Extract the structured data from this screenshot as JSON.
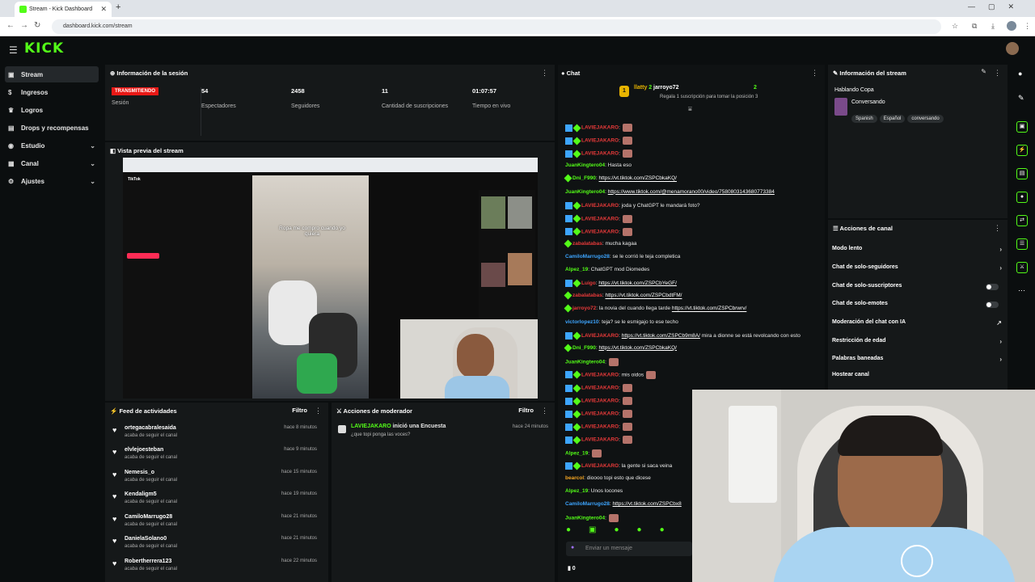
{
  "browser": {
    "tab_title": "Stream - Kick Dashboard",
    "url": "dashboard.kick.com/stream"
  },
  "topbar": {
    "logo": "KICK"
  },
  "sidebar": {
    "items": [
      {
        "label": "Stream",
        "icon": "broadcast-icon",
        "active": true
      },
      {
        "label": "Ingresos",
        "icon": "money-icon"
      },
      {
        "label": "Logros",
        "icon": "trophy-icon"
      },
      {
        "label": "Drops y recompensas",
        "icon": "gift-icon"
      },
      {
        "label": "Estudio",
        "icon": "studio-icon",
        "expandable": true
      },
      {
        "label": "Canal",
        "icon": "channel-icon",
        "expandable": true
      },
      {
        "label": "Ajustes",
        "icon": "gear-icon",
        "expandable": true
      }
    ]
  },
  "session": {
    "title": "Información de la sesión",
    "status": "TRANSMITIENDO",
    "status_label": "Sesión",
    "stats": [
      {
        "value": "54",
        "label": "Espectadores"
      },
      {
        "value": "2458",
        "label": "Seguidores"
      },
      {
        "value": "11",
        "label": "Cantidad de suscripciones"
      },
      {
        "value": "01:07:57",
        "label": "Tiempo en vivo"
      }
    ]
  },
  "preview": {
    "title": "Vista previa del stream",
    "caption": "Ropa me compro cuando yo quiera"
  },
  "feed": {
    "title": "Feed de actividades",
    "filter": "Filtro",
    "items": [
      {
        "name": "ortegacabralesaida",
        "action": "acaba de seguir el canal",
        "time": "hace 8 minutos"
      },
      {
        "name": "elvlejoesteban",
        "action": "acaba de seguir el canal",
        "time": "hace 9 minutos"
      },
      {
        "name": "Nemesis_o",
        "action": "acaba de seguir el canal",
        "time": "hace 15 minutos"
      },
      {
        "name": "Kendaligm5",
        "action": "acaba de seguir el canal",
        "time": "hace 19 minutos"
      },
      {
        "name": "CamiloMarrugo28",
        "action": "acaba de seguir el canal",
        "time": "hace 21 minutos"
      },
      {
        "name": "DanielaSolano0",
        "action": "acaba de seguir el canal",
        "time": "hace 21 minutos"
      },
      {
        "name": "Robertherrera123",
        "action": "acaba de seguir el canal",
        "time": "hace 22 minutos"
      }
    ]
  },
  "mod": {
    "title": "Acciones de moderador",
    "filter": "Filtro",
    "item": {
      "user": "LAVIEJAKARO",
      "action": "inició una Encuesta",
      "detail": "¿que topi ponga las voces?",
      "time": "hace 24 minutos"
    }
  },
  "chat": {
    "title": "Chat",
    "pinned": {
      "rank": "1",
      "user1": "llatty",
      "count1": "2",
      "user2": "jarroyo72",
      "count2": "2",
      "text": "Regala 1 suscripción para tomar la posición 3"
    },
    "messages": [
      {
        "user": "LAVIEJAKARO",
        "color": "#e93a3a",
        "text": ":",
        "link": "",
        "emote": true,
        "badges": true
      },
      {
        "user": "LAVIEJAKARO",
        "color": "#e93a3a",
        "text": ":",
        "link": "",
        "emote": true,
        "badges": true
      },
      {
        "user": "LAVIEJAKARO",
        "color": "#e93a3a",
        "text": ":",
        "link": "",
        "emote": true,
        "badges": true
      },
      {
        "user": "JuanKingtero04",
        "color": "#53fc18",
        "text": ": Hasta eso",
        "link": ""
      },
      {
        "user": "Dni_F990",
        "color": "#53fc18",
        "text": ": ",
        "link": "https://vt.tiktok.com/ZSPCbkaKQ/",
        "badge1": true
      },
      {
        "user": "JuanKingtero04",
        "color": "#53fc18",
        "text": ": ",
        "link": "https://www.tiktok.com/@menamorano00/video/7580803143680773384"
      },
      {
        "user": "LAVIEJAKARO",
        "color": "#e93a3a",
        "text": ": joda y ChatGPT le mandará foto?",
        "link": "",
        "badges": true
      },
      {
        "user": "LAVIEJAKARO",
        "color": "#e93a3a",
        "text": ":",
        "link": "",
        "emote": true,
        "badges": true
      },
      {
        "user": "LAVIEJAKARO",
        "color": "#e93a3a",
        "text": ":",
        "link": "",
        "emote": true,
        "badges": true
      },
      {
        "user": "zabalatabas",
        "color": "#e93a3a",
        "text": ": mucha kagaa",
        "link": "",
        "badge1": true
      },
      {
        "user": "CamiloMarrugo28",
        "color": "#3da5ff",
        "text": ": se le corrió le teja completica",
        "link": ""
      },
      {
        "user": "Alpez_19",
        "color": "#53fc18",
        "text": ": ChatGPT mod Diomedes",
        "link": ""
      },
      {
        "user": "Luigo",
        "color": "#e93a3a",
        "text": ": ",
        "link": "https://vt.tiktok.com/ZSPCbYeGF/",
        "badges": true
      },
      {
        "user": "zabalatabas",
        "color": "#e93a3a",
        "text": ": ",
        "link": "https://vt.tiktok.com/ZSPCbdtFM/",
        "badge1": true
      },
      {
        "user": "jarroyo72",
        "color": "#e93a3a",
        "text": ": la novia del cuando llega tarde ",
        "link": "https://vt.tiktok.com/ZSPCbrwrv/",
        "badge1": true
      },
      {
        "user": "victorlopez10",
        "color": "#3da5ff",
        "text": ": teja? se le esmigajo to ese techo",
        "link": ""
      },
      {
        "user": "LAVIEJAKARO",
        "color": "#e93a3a",
        "text": ": ",
        "link": "https://vt.tiktok.com/ZSPCb9m8A/",
        "after": " mira a dionne se está revolcando con esto",
        "badges": true
      },
      {
        "user": "Dni_F990",
        "color": "#53fc18",
        "text": ": ",
        "link": "https://vt.tiktok.com/ZSPCbkaKQ/",
        "badge1": true
      },
      {
        "user": "JuanKingtero04",
        "color": "#53fc18",
        "text": ":",
        "link": "",
        "emote": true
      },
      {
        "user": "LAVIEJAKARO",
        "color": "#e93a3a",
        "text": ": mis oidos",
        "link": "",
        "emote": true,
        "badges": true
      },
      {
        "user": "LAVIEJAKARO",
        "color": "#e93a3a",
        "text": ":",
        "link": "",
        "emote": true,
        "badges": true
      },
      {
        "user": "LAVIEJAKARO",
        "color": "#e93a3a",
        "text": ":",
        "link": "",
        "emote": true,
        "badges": true
      },
      {
        "user": "LAVIEJAKARO",
        "color": "#e93a3a",
        "text": ":",
        "link": "",
        "emote": true,
        "badges": true
      },
      {
        "user": "LAVIEJAKARO",
        "color": "#e93a3a",
        "text": ":",
        "link": "",
        "emote": true,
        "badges": true
      },
      {
        "user": "LAVIEJAKARO",
        "color": "#e93a3a",
        "text": ":",
        "link": "",
        "emote": true,
        "badges": true
      },
      {
        "user": "Alpez_19",
        "color": "#53fc18",
        "text": ":",
        "link": "",
        "emote": true
      },
      {
        "user": "LAVIEJAKARO",
        "color": "#e93a3a",
        "text": ": la gente si saca veina",
        "link": "",
        "badges": true
      },
      {
        "user": "bearcol",
        "color": "#f5a623",
        "text": ": dioooo topi esto que dicese",
        "link": ""
      },
      {
        "user": "Alpez_19",
        "color": "#53fc18",
        "text": ": Unos locones",
        "link": ""
      },
      {
        "user": "CamiloMarrugo28",
        "color": "#3da5ff",
        "text": ": ",
        "link": "https://vt.tiktok.com/ZSPCbx8"
      },
      {
        "user": "JuanKingtero04",
        "color": "#53fc18",
        "text": ":",
        "link": "",
        "emote": true
      }
    ],
    "input_placeholder": "Enviar un mensaje",
    "counter": "0"
  },
  "stream_info": {
    "title": "Información del stream",
    "stream_title": "Hablando Copa",
    "category": "Conversando",
    "tags": [
      "Spanish",
      "Español",
      "conversando"
    ]
  },
  "channel_actions": {
    "title": "Acciones de canal",
    "items": [
      {
        "label": "Modo lento",
        "control": "chevron"
      },
      {
        "label": "Chat de solo-seguidores",
        "control": "chevron"
      },
      {
        "label": "Chat de solo-suscriptores",
        "control": "toggle"
      },
      {
        "label": "Chat de solo-emotes",
        "control": "toggle"
      },
      {
        "label": "Moderación del chat con IA",
        "control": "external"
      },
      {
        "label": "Restricción de edad",
        "control": "chevron"
      },
      {
        "label": "Palabras baneadas",
        "control": "chevron"
      },
      {
        "label": "Hostear canal",
        "control": "none"
      }
    ]
  },
  "colors": {
    "accent": "#53fc18",
    "live": "#e91916",
    "panel": "#151819",
    "bg": "#0b0e0f"
  }
}
